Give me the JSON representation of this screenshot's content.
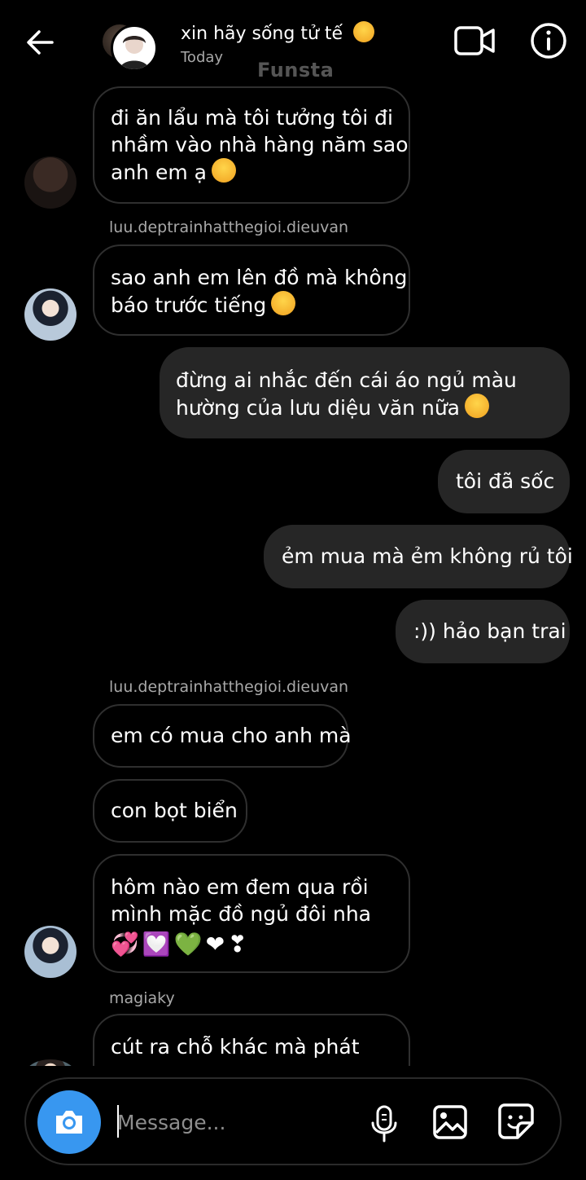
{
  "header": {
    "title": "xin hãy sống tử tế",
    "subtitle": "Today",
    "watermark": "Funsta"
  },
  "messages": [
    {
      "id": "m1",
      "dir": "in",
      "lines": [
        "đi ăn lẩu mà tôi tưởng tôi đi",
        "nhầm vào nhà hàng năm sao",
        "anh em ạ"
      ],
      "emoji": "smiling-face-icon"
    },
    {
      "id": "s1",
      "sender": "luu.deptrainhatthegioi.dieuvan"
    },
    {
      "id": "m2",
      "dir": "in",
      "lines": [
        "sao anh em lên đồ mà không",
        "báo trước tiếng"
      ],
      "emoji": "pleading-face-icon"
    },
    {
      "id": "m3",
      "dir": "out",
      "lines": [
        "đừng ai nhắc đến cái áo ngủ màu",
        "hường của lưu diệu văn nữa"
      ],
      "emoji": "smiling-face-with-hearts-icon"
    },
    {
      "id": "m4",
      "dir": "out",
      "lines": [
        "tôi đã sốc"
      ]
    },
    {
      "id": "m5",
      "dir": "out",
      "lines": [
        "ẻm mua mà ẻm không rủ tôi"
      ]
    },
    {
      "id": "m6",
      "dir": "out",
      "lines": [
        ":)) hảo bạn trai"
      ]
    },
    {
      "id": "s2",
      "sender": "luu.deptrainhatthegioi.dieuvan"
    },
    {
      "id": "m7",
      "dir": "in",
      "lines": [
        "em có mua cho anh mà"
      ]
    },
    {
      "id": "m8",
      "dir": "in",
      "lines": [
        "con bọt biển"
      ]
    },
    {
      "id": "m9",
      "dir": "in",
      "lines": [
        "hôm nào em đem qua rồi",
        "mình mặc đồ ngủ đôi nha"
      ],
      "hearts": "💞💟💚❤❣"
    },
    {
      "id": "s3",
      "sender": "magiaky"
    },
    {
      "id": "m10",
      "dir": "in",
      "lines": [
        "cút ra chỗ khác mà phát"
      ]
    }
  ],
  "composer": {
    "placeholder": "Message..."
  },
  "colors": {
    "background": "#000000",
    "incoming_border": "#2f2f2f",
    "outgoing_bubble": "#262626",
    "camera_button": "#3897f0",
    "secondary_text": "#a8a8a8"
  }
}
